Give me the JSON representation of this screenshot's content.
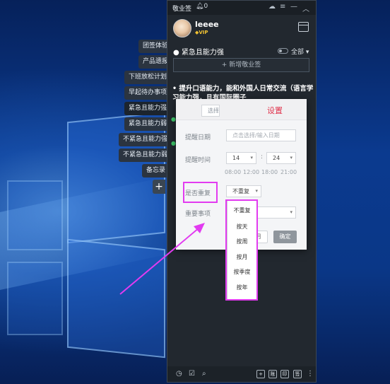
{
  "app": {
    "title": "敬业签",
    "bell_count": "0",
    "user": {
      "name": "leeee",
      "badge": "VIP"
    },
    "category": "紧急且能力强",
    "filter": "全部",
    "new_button": "+ 新增敬业签",
    "note_text": "提升口语能力，能和外国人日常交流（语言学习能力强，且有国际圈子"
  },
  "side_tabs": [
    "团签体验",
    "产品遗报",
    "下班放松计划",
    "早起待办事项",
    "紧急且能力强",
    "紧急且能力弱",
    "不紧急且能力强",
    "不紧急且能力弱",
    "备忘录"
  ],
  "dialog": {
    "tab_select": "选择",
    "tab_settings": "设置",
    "remind_date_label": "提醒日期",
    "remind_date_placeholder": "点击选择/输入日期",
    "remind_time_label": "提醒时间",
    "hour": "14",
    "minute": "24",
    "colon": ":",
    "quick_times": [
      "08:00",
      "12:00",
      "18:00",
      "21:00"
    ],
    "repeat_label": "是否重复",
    "repeat_value": "不重复",
    "important_label": "重要事项",
    "confirm": "确定"
  },
  "repeat_options": [
    "不重复",
    "按天",
    "按周",
    "按月",
    "按季度",
    "按年"
  ],
  "colors": {
    "highlight": "#e23bf0",
    "settings_tab": "#e0334c",
    "app_bg": "#22282f"
  }
}
